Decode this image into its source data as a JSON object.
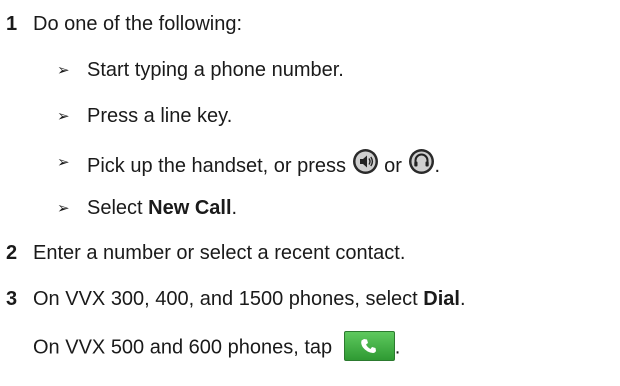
{
  "steps": [
    {
      "num": "1",
      "text": "Do one of the following:"
    },
    {
      "num": "2",
      "text": "Enter a number or select a recent contact."
    },
    {
      "num": "3",
      "text_before": "On VVX 300, 400, and 1500 phones, select ",
      "bold": "Dial",
      "text_after": "."
    }
  ],
  "sub_bullets": {
    "marker": "➢",
    "b1": "Start typing a phone number.",
    "b2": "Press a line key.",
    "b3_before": "Pick up the handset, or press ",
    "b3_or": " or ",
    "b3_after": ".",
    "b4_before": "Select ",
    "b4_bold": "New Call",
    "b4_after": "."
  },
  "step3_note": {
    "text_before": "On VVX 500 and 600 phones, tap ",
    "text_after": "."
  },
  "icons": {
    "speaker": "speakerphone-icon",
    "headset": "headset-icon",
    "dial": "phone-handset-icon"
  },
  "colors": {
    "dial_button": "#3faa3f"
  }
}
